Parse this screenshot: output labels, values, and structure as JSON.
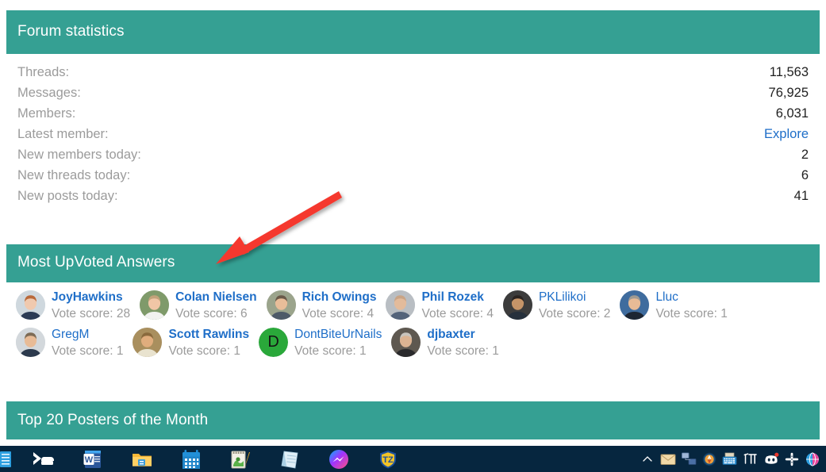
{
  "forum_statistics": {
    "title": "Forum statistics",
    "rows": [
      {
        "label": "Threads:",
        "value": "11,563",
        "is_link": false
      },
      {
        "label": "Messages:",
        "value": "76,925",
        "is_link": false
      },
      {
        "label": "Members:",
        "value": "6,031",
        "is_link": false
      },
      {
        "label": "Latest member:",
        "value": "Explore",
        "is_link": true
      },
      {
        "label": "New members today:",
        "value": "2",
        "is_link": false
      },
      {
        "label": "New threads today:",
        "value": "6",
        "is_link": false
      },
      {
        "label": "New posts today:",
        "value": "41",
        "is_link": false
      }
    ]
  },
  "most_upvoted_answers": {
    "title": "Most UpVoted Answers",
    "score_prefix": "Vote score: ",
    "rows": [
      [
        {
          "name": "JoyHawkins",
          "score": "Vote score: 28",
          "bold": true,
          "avatar": "photo-woman-glasses",
          "avatar_letter": null,
          "avatar_color": "#d9c6b6"
        },
        {
          "name": "Colan Nielsen",
          "score": "Vote score: 6",
          "bold": true,
          "avatar": "photo-man-outdoors",
          "avatar_letter": null,
          "avatar_color": "#8fa87a"
        },
        {
          "name": "Rich Owings",
          "score": "Vote score: 4",
          "bold": true,
          "avatar": "photo-man-smiling",
          "avatar_letter": null,
          "avatar_color": "#b6a48f"
        },
        {
          "name": "Phil Rozek",
          "score": "Vote score: 4",
          "bold": true,
          "avatar": "photo-man-bald",
          "avatar_letter": null,
          "avatar_color": "#9aa7b0"
        },
        {
          "name": "PKLilikoi",
          "score": "Vote score: 2",
          "bold": false,
          "avatar": "photo-man-beard-glasses",
          "avatar_letter": null,
          "avatar_color": "#4a4a4a"
        },
        {
          "name": "Lluc",
          "score": "Vote score: 1",
          "bold": false,
          "avatar": "photo-man-suit-blue",
          "avatar_letter": null,
          "avatar_color": "#3f6c9e"
        }
      ],
      [
        {
          "name": "GregM",
          "score": "Vote score: 1",
          "bold": false,
          "avatar": "photo-man-suit-arms-crossed",
          "avatar_letter": null,
          "avatar_color": "#c8cdd2"
        },
        {
          "name": "Scott Rawlins",
          "score": "Vote score: 1",
          "bold": true,
          "avatar": "photo-man-tan",
          "avatar_letter": null,
          "avatar_color": "#b09a6e"
        },
        {
          "name": "DontBiteUrNails",
          "score": "Vote score: 1",
          "bold": false,
          "avatar": "letter",
          "avatar_letter": "D",
          "avatar_color": "#2aa83a"
        },
        {
          "name": "djbaxter",
          "score": "Vote score: 1",
          "bold": true,
          "avatar": "photo-older-man",
          "avatar_letter": null,
          "avatar_color": "#6e6259"
        }
      ]
    ]
  },
  "top_posters": {
    "title": "Top 20 Posters of the Month"
  },
  "annotation": {
    "shape": "red-arrow",
    "color": "#f5392e",
    "points_to": "Most UpVoted Answers"
  },
  "theme": {
    "header_teal": "#35a093",
    "link_blue": "#1e6ec8",
    "muted_gray": "#9b9b9b",
    "page_white": "#ffffff",
    "taskbar_navy": "#06263f"
  },
  "taskbar": {
    "pinned": [
      {
        "name": "terminal-icon",
        "label": "Terminal"
      },
      {
        "name": "word-icon",
        "label": "Word"
      },
      {
        "name": "file-explorer-icon",
        "label": "File Explorer"
      },
      {
        "name": "calendar-icon",
        "label": "Calendar"
      },
      {
        "name": "notes-app-icon",
        "label": "Notes"
      },
      {
        "name": "notepad-icon",
        "label": "Notepad"
      },
      {
        "name": "messenger-icon",
        "label": "Messenger"
      },
      {
        "name": "trustedzone-icon",
        "label": "TZ"
      }
    ],
    "tray": [
      {
        "name": "show-hidden-icons-chevron-icon",
        "label": "Show hidden icons"
      },
      {
        "name": "mail-icon",
        "label": "Mail"
      },
      {
        "name": "network-icon",
        "label": "Network"
      },
      {
        "name": "compass-icon",
        "label": "Compass"
      },
      {
        "name": "keyboard-icon",
        "label": "Keyboard"
      },
      {
        "name": "pi-tool-icon",
        "label": "Pi"
      },
      {
        "name": "discord-icon",
        "label": "Discord"
      },
      {
        "name": "slack-icon",
        "label": "Slack"
      },
      {
        "name": "browser-icon",
        "label": "Browser"
      }
    ]
  }
}
